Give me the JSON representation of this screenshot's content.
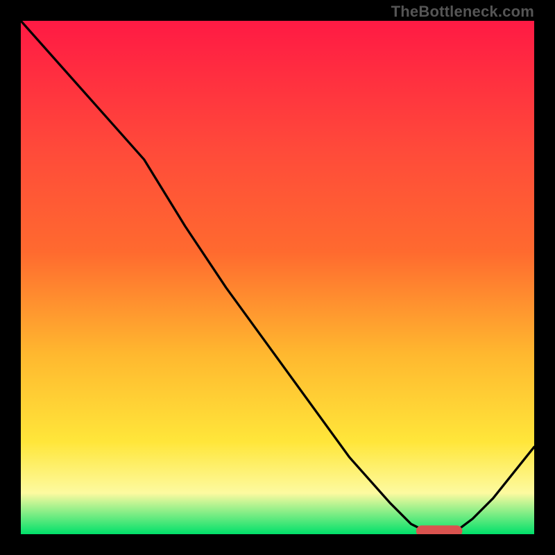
{
  "watermark": "TheBottleneck.com",
  "colors": {
    "frame": "#000000",
    "gradient_top": "#ff1a44",
    "gradient_mid1": "#ff6a2f",
    "gradient_mid2": "#ffb82f",
    "gradient_mid3": "#ffe63a",
    "gradient_mid4": "#fdfaa0",
    "gradient_bottom": "#00e06a",
    "curve": "#000000",
    "marker": "#d9534f"
  },
  "chart_data": {
    "type": "line",
    "title": "",
    "xlabel": "",
    "ylabel": "",
    "xlim": [
      0,
      100
    ],
    "ylim": [
      0,
      100
    ],
    "grid": false,
    "legend": false,
    "series": [
      {
        "name": "curve",
        "x": [
          0,
          8,
          16,
          24,
          32,
          40,
          48,
          56,
          64,
          72,
          76,
          80,
          84,
          88,
          92,
          96,
          100
        ],
        "y": [
          100,
          91,
          82,
          73,
          60,
          48,
          37,
          26,
          15,
          6,
          2,
          0,
          0,
          3,
          7,
          12,
          17
        ]
      }
    ],
    "marker": {
      "x_start": 77,
      "x_end": 86,
      "y": 0.6,
      "thickness": 2.2
    }
  }
}
